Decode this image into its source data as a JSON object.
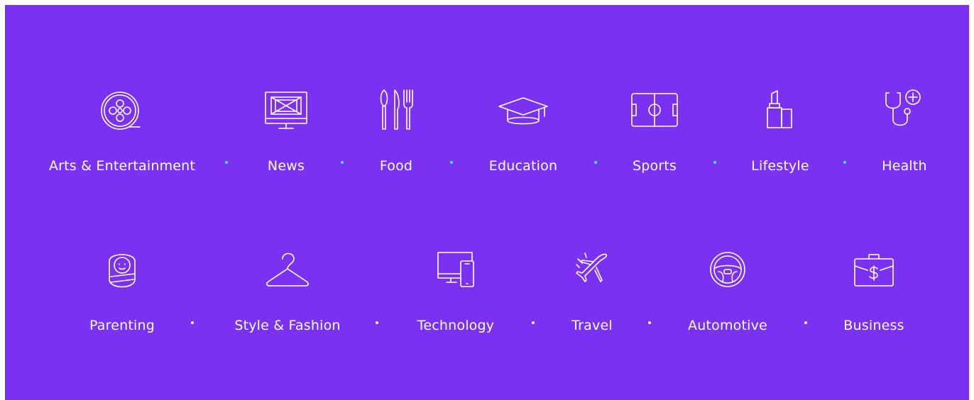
{
  "categories": {
    "row1": [
      {
        "label": "Arts & Entertainment",
        "icon": "film-reel-icon"
      },
      {
        "label": "News",
        "icon": "monitor-news-icon"
      },
      {
        "label": "Food",
        "icon": "cutlery-icon"
      },
      {
        "label": "Education",
        "icon": "graduation-cap-icon"
      },
      {
        "label": "Sports",
        "icon": "soccer-field-icon"
      },
      {
        "label": "Lifestyle",
        "icon": "lipstick-icon"
      },
      {
        "label": "Health",
        "icon": "stethoscope-icon"
      }
    ],
    "row2": [
      {
        "label": "Parenting",
        "icon": "baby-icon"
      },
      {
        "label": "Style & Fashion",
        "icon": "hanger-icon"
      },
      {
        "label": "Technology",
        "icon": "devices-icon"
      },
      {
        "label": "Travel",
        "icon": "airplane-icon"
      },
      {
        "label": "Automotive",
        "icon": "steering-wheel-icon"
      },
      {
        "label": "Business",
        "icon": "briefcase-icon"
      }
    ]
  },
  "colors": {
    "background": "#7a31f1",
    "text": "#ffffff",
    "separator_row1": "#45e8b4",
    "separator_row2": "#ffffff"
  }
}
